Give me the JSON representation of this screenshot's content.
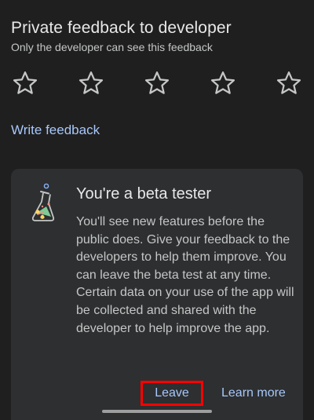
{
  "feedback": {
    "title": "Private feedback to developer",
    "subtitle": "Only the developer can see this feedback",
    "rating": {
      "stars_total": 5,
      "stars_selected": 0
    },
    "write_link": "Write feedback"
  },
  "beta_card": {
    "icon": "beta-flask-icon",
    "title": "You're a beta tester",
    "body": "You'll see new features before the public does. Give your feedback to the developers to help them improve. You can leave the beta test at any time. Certain data on your use of the app will be collected and shared with the developer to help improve the app.",
    "leave_label": "Leave",
    "learn_more_label": "Learn more"
  },
  "colors": {
    "background": "#1f1f1f",
    "card": "#2d2f31",
    "link": "#a8c7fa",
    "highlight": "#ff0000"
  }
}
